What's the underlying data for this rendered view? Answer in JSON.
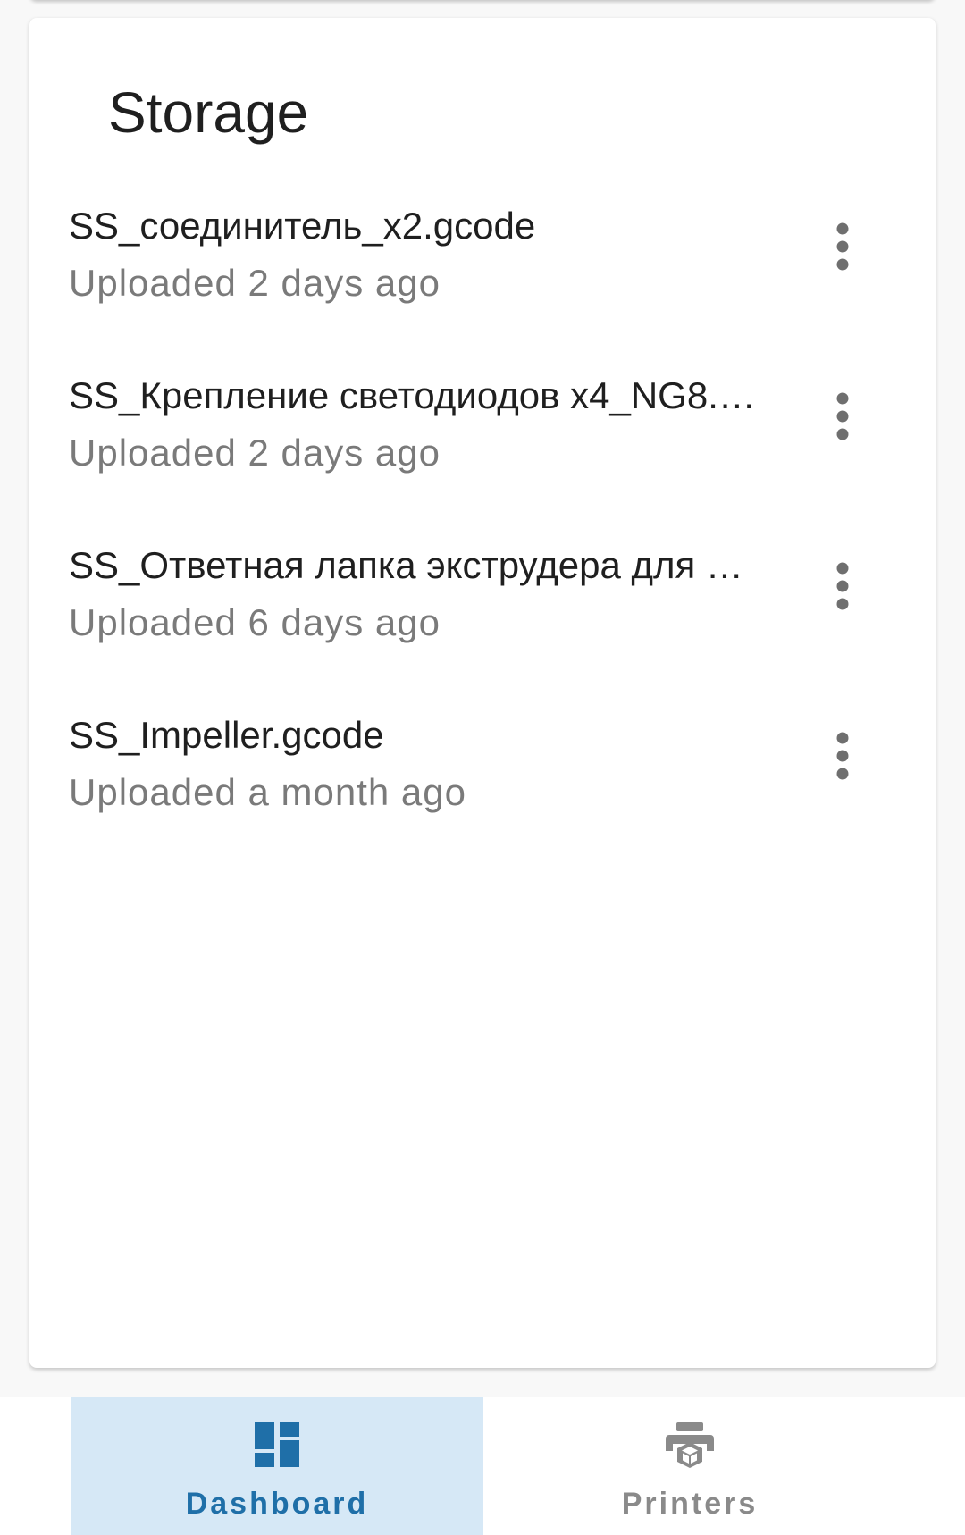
{
  "storage": {
    "title": "Storage",
    "files": [
      {
        "name": "SS_соединитель_x2.gcode",
        "meta": "Uploaded 2 days ago"
      },
      {
        "name": "SS_Крепление светодиодов x4_NG8.…",
        "meta": "Uploaded 2 days ago"
      },
      {
        "name": "SS_Ответная лапка экструдера для …",
        "meta": "Uploaded 6 days ago"
      },
      {
        "name": "SS_Impeller.gcode",
        "meta": "Uploaded a month ago"
      }
    ],
    "more_icon": "more-vert-icon"
  },
  "bottom_nav": {
    "items": [
      {
        "label": "Dashboard",
        "icon": "dashboard-icon",
        "active": true,
        "color": "#1f6fa8"
      },
      {
        "label": "Printers",
        "icon": "printer-icon",
        "active": false,
        "color": "#8a8a8a"
      }
    ]
  },
  "colors": {
    "accent": "#1f6fa8",
    "active_tab_bg": "#d6e8f6",
    "background": "#f8f8f8"
  }
}
